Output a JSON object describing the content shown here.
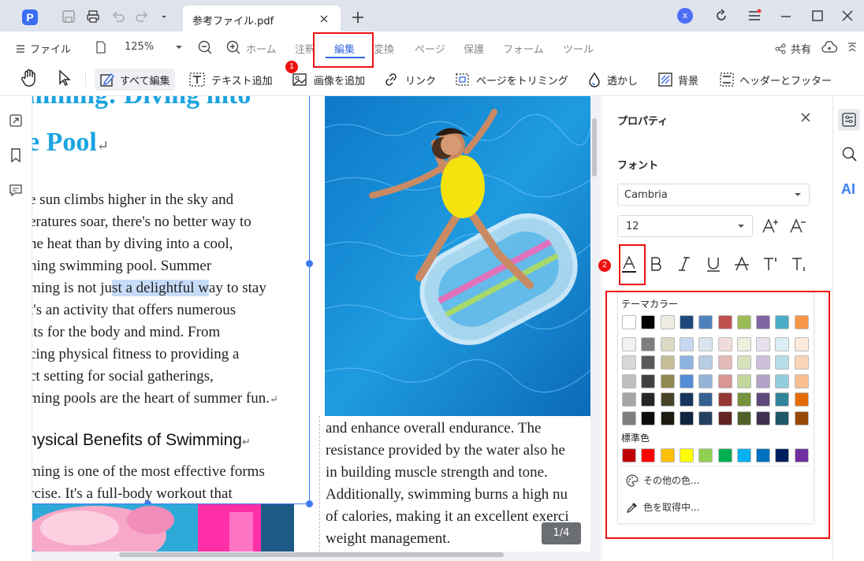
{
  "titlebar": {
    "tab_title": "参考ファイル.pdf",
    "avatar_initial": "x"
  },
  "menu": {
    "file": "ファイル",
    "zoom": "125%",
    "items": [
      "ホーム",
      "注釈",
      "編集",
      "変換",
      "ページ",
      "保護",
      "フォーム",
      "ツール"
    ],
    "share": "共有"
  },
  "toolbar": {
    "edit_all": "すべて編集",
    "add_text": "テキスト追加",
    "add_image": "画像を追加",
    "link": "リンク",
    "crop_page": "ページをトリミング",
    "watermark": "透かし",
    "background": "背景",
    "header_footer": "ヘッダーとフッター"
  },
  "document": {
    "heading_line1": "mming: Diving into",
    "heading_line2": "e Pool",
    "body_left": [
      "e sun climbs higher in the sky and",
      "eratures soar, there's no better way to",
      "he heat than by diving into a cool,",
      "hing swimming pool. Summer",
      "ming is not ju",
      "st a delightful w",
      "ay to stay",
      "t's an activity that offers numerous",
      "its for the body and mind. From",
      "cing physical fitness to providing a",
      "ct setting for social gatherings,",
      "ming pools are the heart of summer fun."
    ],
    "subheading": "hysical Benefits of Swimming",
    "body_left2": [
      "ming is one of the most effective forms",
      "rcise. It's a full-body workout that"
    ],
    "body_right": [
      "and enhance overall endurance. The",
      "resistance provided by the water also he",
      "in building muscle strength and tone.",
      "Additionally, swimming burns a high nu",
      "of calories, making it an excellent exerci",
      "weight management."
    ],
    "page_indicator": "1/4",
    "return_mark": "↵"
  },
  "panel": {
    "title": "プロパティ",
    "font_section": "フォント",
    "font_family": "Cambria",
    "font_size": "12",
    "theme_colors_label": "テーマカラー",
    "standard_colors_label": "標準色",
    "more_colors": "その他の色...",
    "pick_color": "色を取得中..."
  },
  "theme_colors": [
    [
      "#ffffff",
      "#000000",
      "#eeece1",
      "#1f497d",
      "#4f81bd",
      "#c0504d",
      "#9bbb59",
      "#8064a2",
      "#4bacc6",
      "#f79646"
    ],
    [
      "#f2f2f2",
      "#7f7f7f",
      "#ddd9c3",
      "#c6d9f0",
      "#dbe5f1",
      "#f2dcdb",
      "#ebf1dd",
      "#e5e0ec",
      "#dbeef3",
      "#fdeada"
    ],
    [
      "#d8d8d8",
      "#595959",
      "#c4bd97",
      "#8db3e2",
      "#b8cce4",
      "#e5b9b7",
      "#d7e3bc",
      "#ccc1d9",
      "#b7dde8",
      "#fbd5b5"
    ],
    [
      "#bfbfbf",
      "#3f3f3f",
      "#938953",
      "#548dd4",
      "#95b3d7",
      "#d99694",
      "#c3d69b",
      "#b2a2c7",
      "#92cddc",
      "#fac08f"
    ],
    [
      "#a5a5a5",
      "#262626",
      "#494429",
      "#17365d",
      "#366092",
      "#953734",
      "#76923c",
      "#5f497a",
      "#31859b",
      "#e36c09"
    ],
    [
      "#7f7f7f",
      "#0c0c0c",
      "#1d1b10",
      "#0f243e",
      "#244061",
      "#632423",
      "#4f6128",
      "#3f3151",
      "#205867",
      "#974806"
    ]
  ],
  "standard_colors": [
    "#c00000",
    "#ff0000",
    "#ffc000",
    "#ffff00",
    "#92d050",
    "#00b050",
    "#00b0f0",
    "#0070c0",
    "#002060",
    "#7030a0"
  ],
  "annotations": {
    "badge1": "1",
    "badge2": "2"
  },
  "ai_label": "AI"
}
